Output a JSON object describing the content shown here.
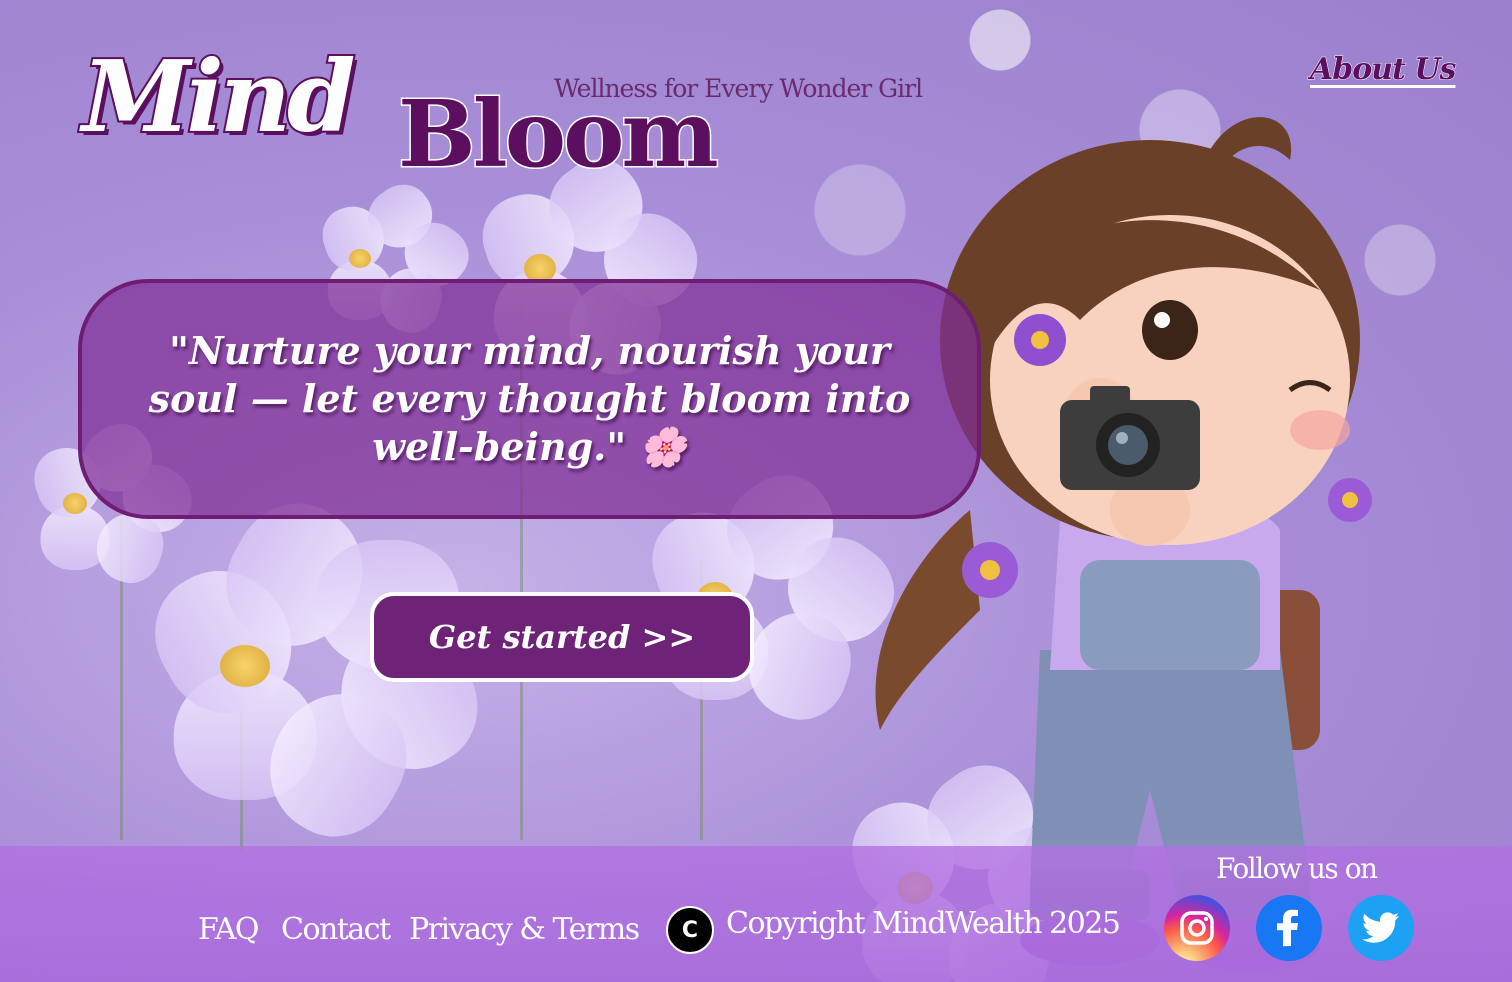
{
  "header": {
    "logo_word1": "Mind",
    "logo_word2": "Bloom",
    "tagline": "Wellness for Every Wonder Girl",
    "about_label": "About Us"
  },
  "hero": {
    "quote": "\"Nurture your mind, nourish your soul — let every thought bloom into well-being.\" 🌸",
    "cta_label": "Get started >>"
  },
  "footer": {
    "links": [
      "FAQ",
      "Contact",
      "Privacy & Terms"
    ],
    "copyright_symbol": "C",
    "copyright_text": "Copyright MindWealth 2025",
    "follow_label": "Follow us on",
    "social": [
      {
        "name": "instagram-icon",
        "color": "#d6249f"
      },
      {
        "name": "facebook-icon",
        "color": "#1877f2"
      },
      {
        "name": "twitter-icon",
        "color": "#1da1f2"
      }
    ]
  },
  "colors": {
    "brand_dark": "#5b0f5e",
    "quote_bg": "#802e96",
    "cta_bg": "#6f2378",
    "footer_bg": "#b270e2"
  }
}
